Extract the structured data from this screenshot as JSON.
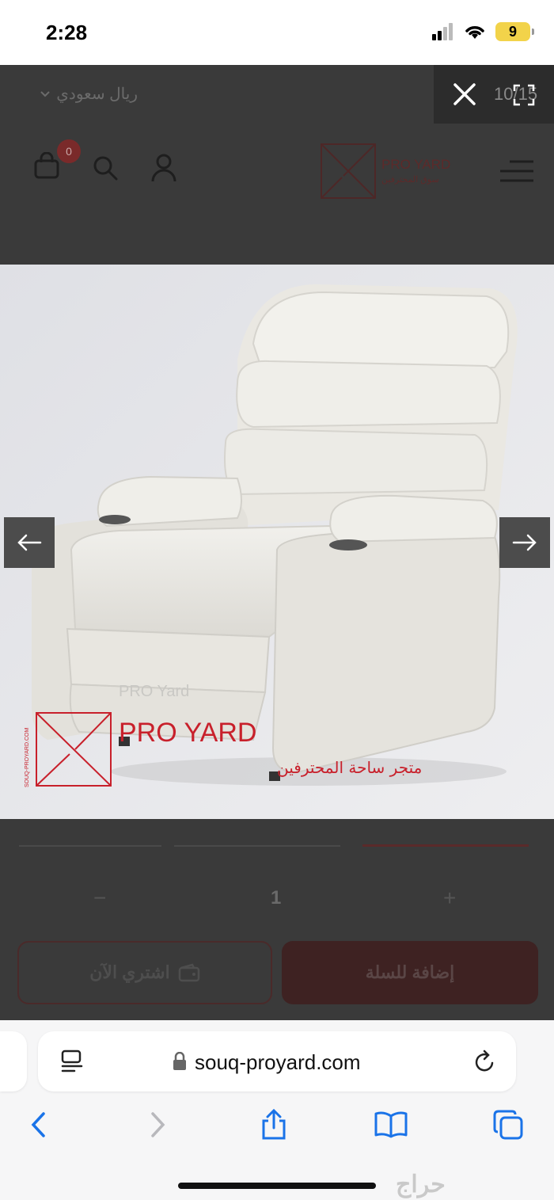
{
  "status_bar": {
    "time": "2:28",
    "battery": "9"
  },
  "site": {
    "currency_label": "ريال سعودي",
    "cart_count": "0",
    "logo_text": "PRO YARD",
    "logo_subtext": "سوق المحترفين",
    "quantity": "1",
    "qty_minus": "−",
    "qty_plus": "+",
    "buy_now_label": "اشتري الآن",
    "add_to_cart_label": "إضافة للسلة"
  },
  "lightbox": {
    "counter": "10/15"
  },
  "product_image": {
    "brand_on_seat": "PRO Yard",
    "watermark_name": "PRO YARD",
    "watermark_sub": "متجر ساحة المحترفين",
    "watermark_vertical": "SOUQ-PROYARD.COM"
  },
  "safari": {
    "url": "souq-proyard.com"
  },
  "app_watermark": "حراج",
  "colors": {
    "brand_red": "#c8202b",
    "chair": "#eceae4"
  }
}
